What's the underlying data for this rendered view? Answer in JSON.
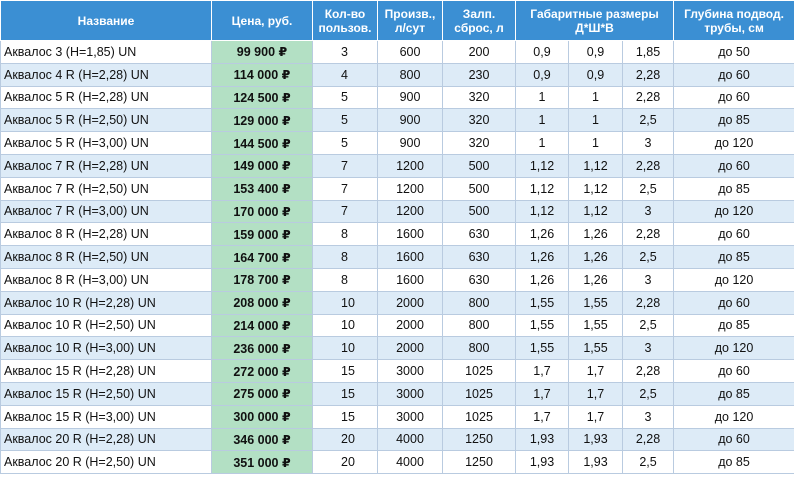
{
  "colors": {
    "header_bg": "#3b8fd3",
    "header_text": "#ffffff",
    "row_alt_bg": "#ddebf7",
    "price_bg": "#b3e0c4",
    "grid_line": "#b9cbe0"
  },
  "table": {
    "headers": {
      "name": "Название",
      "price": "Цена, руб.",
      "users_line1": "Кол-во",
      "users_line2": "пользов.",
      "prod_line1": "Произв.,",
      "prod_line2": "л/сут",
      "drop_line1": "Залп.",
      "drop_line2": "сброс, л",
      "dims_line1": "Габаритные размеры",
      "dims_line2": "Д*Ш*В",
      "depth_line1": "Глубина подвод.",
      "depth_line2": "трубы, см"
    },
    "rows": [
      [
        "Аквалос 3 (Н=1,85) UN",
        "99 900 ₽",
        "3",
        "600",
        "200",
        "0,9",
        "0,9",
        "1,85",
        "до 50"
      ],
      [
        "Аквалос 4 R (Н=2,28) UN",
        "114 000 ₽",
        "4",
        "800",
        "230",
        "0,9",
        "0,9",
        "2,28",
        "до 60"
      ],
      [
        "Аквалос 5 R (Н=2,28) UN",
        "124 500 ₽",
        "5",
        "900",
        "320",
        "1",
        "1",
        "2,28",
        "до 60"
      ],
      [
        "Аквалос 5 R (Н=2,50) UN",
        "129 000 ₽",
        "5",
        "900",
        "320",
        "1",
        "1",
        "2,5",
        "до 85"
      ],
      [
        "Аквалос 5 R (Н=3,00) UN",
        "144 500 ₽",
        "5",
        "900",
        "320",
        "1",
        "1",
        "3",
        "до 120"
      ],
      [
        "Аквалос 7 R (Н=2,28) UN",
        "149 000 ₽",
        "7",
        "1200",
        "500",
        "1,12",
        "1,12",
        "2,28",
        "до 60"
      ],
      [
        "Аквалос 7 R (Н=2,50) UN",
        "153 400 ₽",
        "7",
        "1200",
        "500",
        "1,12",
        "1,12",
        "2,5",
        "до 85"
      ],
      [
        "Аквалос 7 R (Н=3,00) UN",
        "170 000 ₽",
        "7",
        "1200",
        "500",
        "1,12",
        "1,12",
        "3",
        "до 120"
      ],
      [
        "Аквалос 8 R (Н=2,28) UN",
        "159 000 ₽",
        "8",
        "1600",
        "630",
        "1,26",
        "1,26",
        "2,28",
        "до 60"
      ],
      [
        "Аквалос 8 R (Н=2,50) UN",
        "164 700 ₽",
        "8",
        "1600",
        "630",
        "1,26",
        "1,26",
        "2,5",
        "до 85"
      ],
      [
        "Аквалос 8 R (Н=3,00) UN",
        "178 700 ₽",
        "8",
        "1600",
        "630",
        "1,26",
        "1,26",
        "3",
        "до 120"
      ],
      [
        "Аквалос 10 R (Н=2,28) UN",
        "208 000 ₽",
        "10",
        "2000",
        "800",
        "1,55",
        "1,55",
        "2,28",
        "до 60"
      ],
      [
        "Аквалос 10 R (Н=2,50) UN",
        "214 000 ₽",
        "10",
        "2000",
        "800",
        "1,55",
        "1,55",
        "2,5",
        "до 85"
      ],
      [
        "Аквалос 10 R (Н=3,00) UN",
        "236 000 ₽",
        "10",
        "2000",
        "800",
        "1,55",
        "1,55",
        "3",
        "до 120"
      ],
      [
        "Аквалос 15 R (Н=2,28) UN",
        "272 000 ₽",
        "15",
        "3000",
        "1025",
        "1,7",
        "1,7",
        "2,28",
        "до 60"
      ],
      [
        "Аквалос 15 R (Н=2,50) UN",
        "275 000 ₽",
        "15",
        "3000",
        "1025",
        "1,7",
        "1,7",
        "2,5",
        "до 85"
      ],
      [
        "Аквалос 15 R (Н=3,00) UN",
        "300 000 ₽",
        "15",
        "3000",
        "1025",
        "1,7",
        "1,7",
        "3",
        "до 120"
      ],
      [
        "Аквалос 20 R (Н=2,28) UN",
        "346 000 ₽",
        "20",
        "4000",
        "1250",
        "1,93",
        "1,93",
        "2,28",
        "до 60"
      ],
      [
        "Аквалос 20 R (Н=2,50) UN",
        "351 000 ₽",
        "20",
        "4000",
        "1250",
        "1,93",
        "1,93",
        "2,5",
        "до 85"
      ]
    ]
  }
}
